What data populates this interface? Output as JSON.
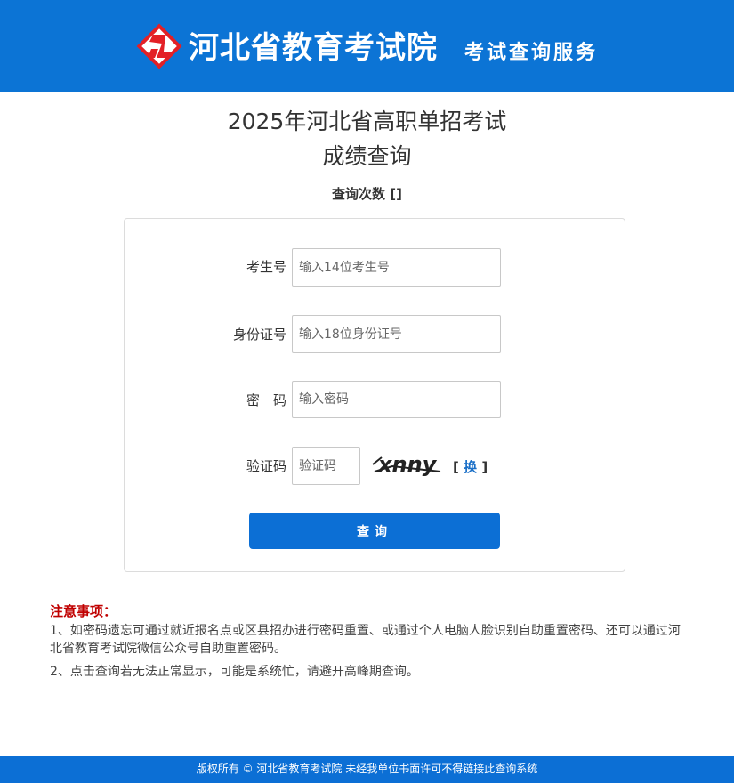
{
  "header": {
    "site_title": "河北省教育考试院",
    "site_subtitle": "考试查询服务",
    "brand_color": "#0c74d5",
    "logo_color": "#e32026"
  },
  "page": {
    "exam_title": "2025年河北省高职单招考试",
    "title": "成绩查询",
    "query_count": "查询次数 []"
  },
  "form": {
    "candidate_no": {
      "label": "考生号",
      "placeholder": "输入14位考生号",
      "value": ""
    },
    "id_no": {
      "label": "身份证号",
      "placeholder": "输入18位身份证号",
      "value": ""
    },
    "password": {
      "label": "密　码",
      "placeholder": "输入密码",
      "value": ""
    },
    "captcha": {
      "label": "验证码",
      "placeholder": "验证码",
      "value": "",
      "image_text": "xnny"
    },
    "refresh": {
      "open": "[ ",
      "label": "换",
      "close": " ]"
    },
    "submit_label": "查询",
    "submit_color": "#0c6fd5"
  },
  "notes": {
    "title": "注意事项：",
    "items": [
      "1、如密码遗忘可通过就近报名点或区县招办进行密码重置、或通过个人电脑人脸识别自助重置密码、还可以通过河北省教育考试院微信公众号自助重置密码。",
      "2、点击查询若无法正常显示，可能是系统忙，请避开高峰期查询。"
    ],
    "title_color": "#c00000"
  },
  "footer": {
    "text": "版权所有 © 河北省教育考试院 未经我单位书面许可不得链接此查询系统"
  }
}
